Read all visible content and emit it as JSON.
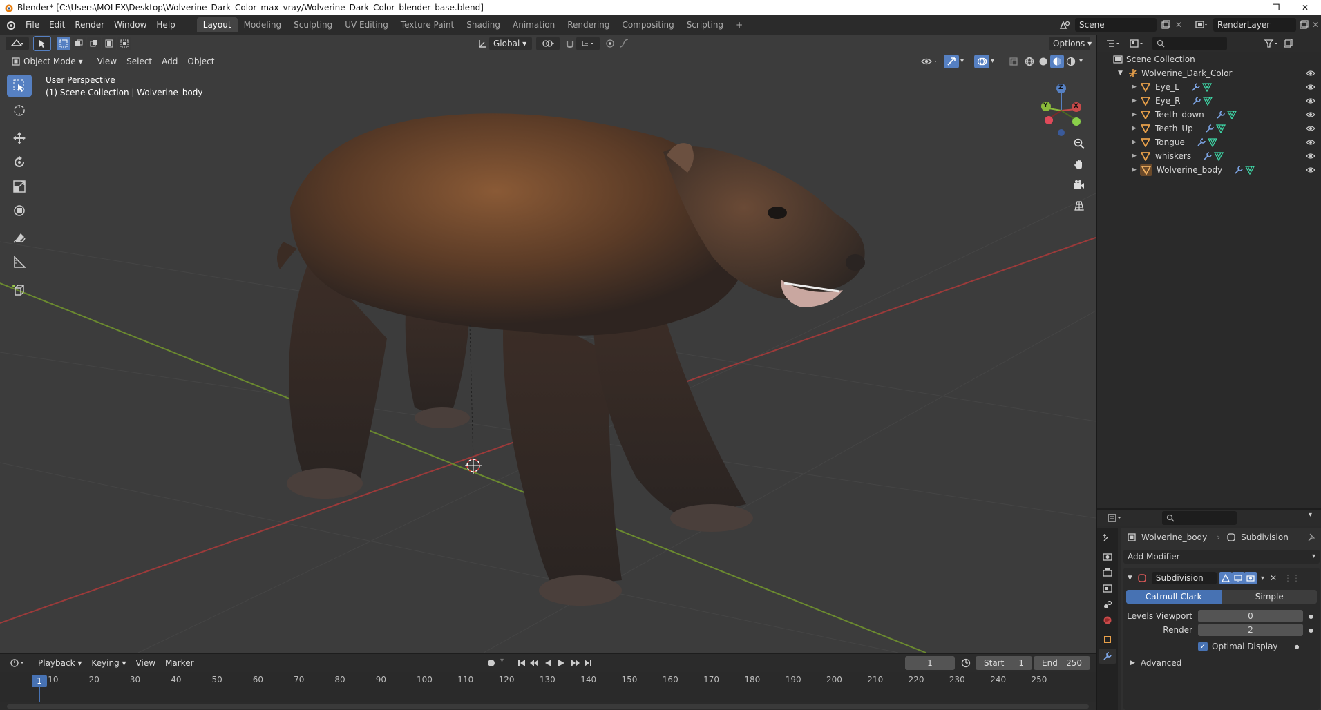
{
  "window": {
    "title": "Blender* [C:\\Users\\MOLEX\\Desktop\\Wolverine_Dark_Color_max_vray/Wolverine_Dark_Color_blender_base.blend]",
    "minimize": "—",
    "maximize": "❐",
    "close": "✕"
  },
  "menu": {
    "items": [
      "File",
      "Edit",
      "Render",
      "Window",
      "Help"
    ],
    "workspaces": [
      "Layout",
      "Modeling",
      "Sculpting",
      "UV Editing",
      "Texture Paint",
      "Shading",
      "Animation",
      "Rendering",
      "Compositing",
      "Scripting"
    ],
    "active_workspace": "Layout",
    "add_workspace": "+",
    "scene": "Scene",
    "render_layer": "RenderLayer"
  },
  "viewport": {
    "transform_orientation": "Global",
    "options": "Options",
    "mode": "Object Mode",
    "header_menus": [
      "View",
      "Select",
      "Add",
      "Object"
    ],
    "overlay_line1": "User Perspective",
    "overlay_line2": "(1) Scene Collection | Wolverine_body",
    "gizmo_axes": {
      "x": "X",
      "y": "Y",
      "z": "Z"
    },
    "colors": {
      "bg": "#3c3c3c",
      "x_axis": "#9c3a3a",
      "y_axis": "#6b8a2f",
      "active_tool": "#5680c2"
    }
  },
  "outliner": {
    "root": "Scene Collection",
    "collection": "Wolverine_Dark_Color",
    "objects": [
      "Eye_L",
      "Eye_R",
      "Teeth_down",
      "Teeth_Up",
      "Tongue",
      "whiskers",
      "Wolverine_body"
    ]
  },
  "properties": {
    "object_name": "Wolverine_body",
    "modifier_context": "Subdivision",
    "add_modifier": "Add Modifier",
    "modifier_name": "Subdivision",
    "algorithms": [
      "Catmull-Clark",
      "Simple"
    ],
    "active_algorithm": "Catmull-Clark",
    "levels_viewport_label": "Levels Viewport",
    "levels_viewport_value": "0",
    "render_label": "Render",
    "render_value": "2",
    "optimal_display_label": "Optimal Display",
    "optimal_display_checked": true,
    "advanced_label": "Advanced"
  },
  "timeline": {
    "menus": [
      "Playback",
      "Keying",
      "View",
      "Marker"
    ],
    "current_frame": "1",
    "start_label": "Start",
    "start_value": "1",
    "end_label": "End",
    "end_value": "250",
    "ticks": [
      "10",
      "20",
      "30",
      "40",
      "50",
      "60",
      "70",
      "80",
      "90",
      "100",
      "110",
      "120",
      "130",
      "140",
      "150",
      "160",
      "170",
      "180",
      "190",
      "200",
      "210",
      "220",
      "230",
      "240",
      "250"
    ],
    "playhead": "1"
  }
}
